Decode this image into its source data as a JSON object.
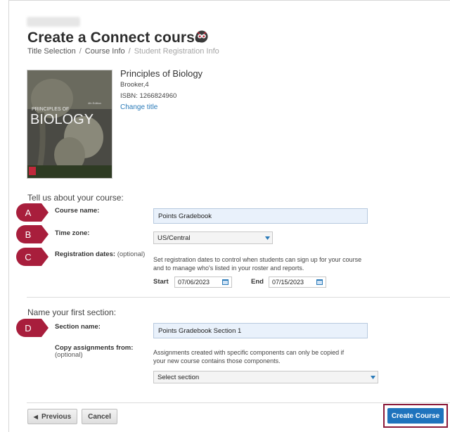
{
  "page": {
    "title": "Create a Connect course",
    "breadcrumb": [
      "Title Selection",
      "Course Info",
      "Student Registration Info"
    ]
  },
  "book": {
    "title": "Principles of Biology",
    "author": "Brooker,4",
    "isbn": "ISBN: 1266824960",
    "change_link": "Change title",
    "cover_text": "BIOLOGY"
  },
  "course_section": {
    "heading": "Tell us about your course:",
    "course_name_label": "Course name:",
    "course_name_value": "Points Gradebook",
    "time_zone_label": "Time zone:",
    "time_zone_value": "US/Central",
    "reg_dates_label": "Registration dates:",
    "reg_dates_optional": "(optional)",
    "reg_dates_help": "Set registration dates to control when students can sign up for your course and to manage who's listed in your roster and reports.",
    "start_label": "Start",
    "start_value": "07/06/2023",
    "end_label": "End",
    "end_value": "07/15/2023"
  },
  "first_section": {
    "heading": "Name your first section:",
    "section_name_label": "Section name:",
    "section_name_value": "Points Gradebook Section 1",
    "copy_label": "Copy assignments from:",
    "copy_optional": "(optional)",
    "copy_help": "Assignments created with specific components can only be copied if your new course contains those components.",
    "select_value": "Select section"
  },
  "badges": [
    "A",
    "B",
    "C",
    "D"
  ],
  "footer": {
    "previous": "Previous",
    "cancel": "Cancel",
    "create": "Create Course"
  },
  "colors": {
    "badge": "#a81e3c",
    "link": "#2a7ab8",
    "primary": "#1f73bd",
    "highlight_border": "#8b1a3a"
  }
}
